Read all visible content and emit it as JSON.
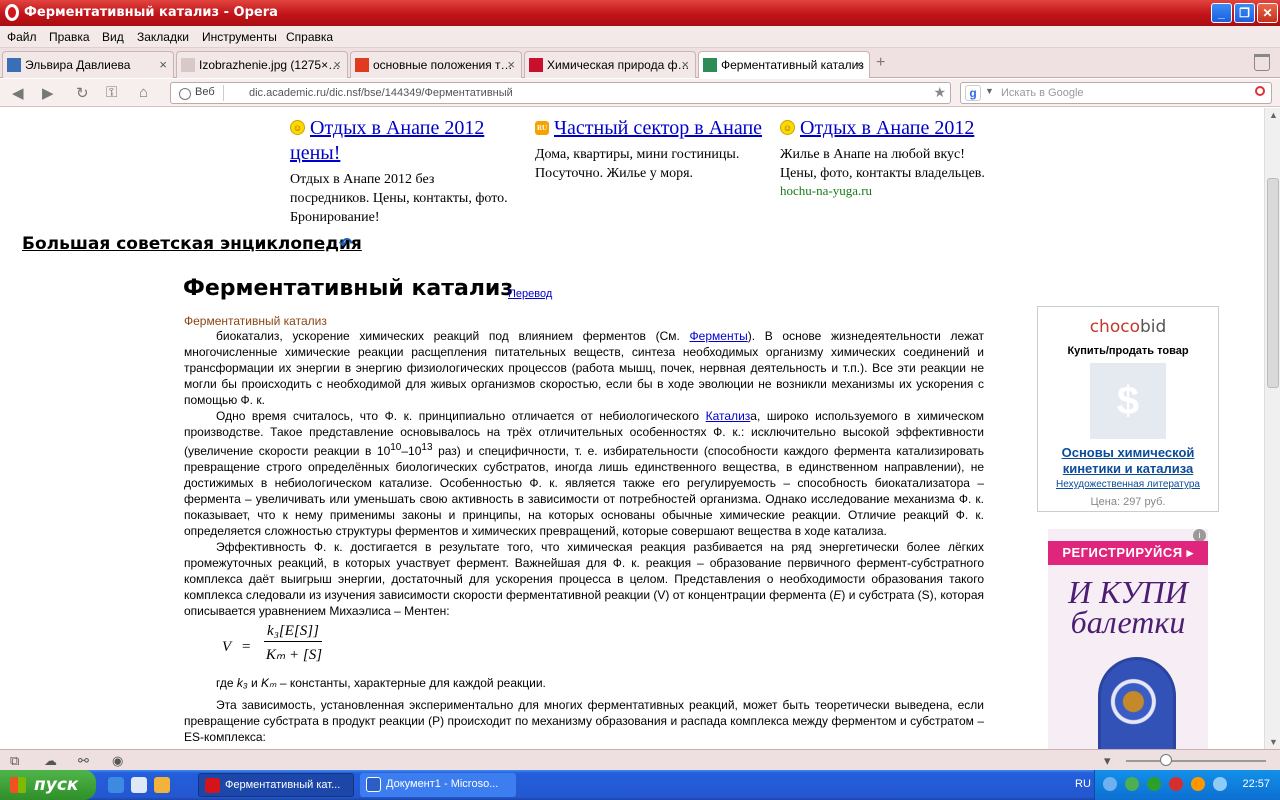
{
  "window": {
    "title": "Ферментативный катализ - Opera",
    "buttons": [
      "_",
      "❐",
      "✕"
    ]
  },
  "menu": [
    "Файл",
    "Правка",
    "Вид",
    "Закладки",
    "Инструменты",
    "Справка"
  ],
  "tabs": [
    {
      "label": "Эльвира Давлиева",
      "icon_color": "#3a6fb8"
    },
    {
      "label": "Izobrazhenie.jpg (1275×…",
      "icon_color": "#d9c8c8"
    },
    {
      "label": "основные положения т…",
      "icon_color": "#e03b1f"
    },
    {
      "label": "Химическая природа ф…",
      "icon_color": "#c8102e"
    },
    {
      "label": "Ферментативный катализ",
      "icon_color": "#2e8b57"
    }
  ],
  "address": {
    "web_label": "Веб",
    "url": "dic.academic.ru/dic.nsf/bse/144349/Ферментативный",
    "search_placeholder": "Искать в Google"
  },
  "ads": [
    {
      "headline": "Отдых в Анапе 2012 цены!",
      "body": "Отдых в Анапе 2012 без посредников. Цены, контакты, фото. Бронирование!",
      "icon": "smiley-icon"
    },
    {
      "headline": "Частный сектор в Анапе",
      "body": "Дома, квартиры, мини гостиницы. Посуточно. Жилье у моря.",
      "icon": "rss-icon"
    },
    {
      "headline": "Отдых в Анапе 2012",
      "body": "Жилье в Анапе на любой вкус! Цены, фото, контакты владельцев.",
      "source": "hochu-na-yuga.ru",
      "icon": "smiley-icon"
    }
  ],
  "encyclopedia": "Большая советская энциклопедия",
  "article": {
    "title": "Ферментативный катализ",
    "translate_link": "Перевод",
    "subtitle": "Ферментативный катализ",
    "p1_a": "биокатализ, ускорение химических реакций под влиянием ферментов (См. ",
    "p1_link": "Ферменты",
    "p1_b": "). В основе жизнедеятельности лежат многочисленные химические реакции расщепления питательных веществ, синтеза необходимых организму химических соединений и трансформации их энергии в энергию физиологических процессов (работа мышц, почек, нервная деятельность и т.п.). Все эти реакции не могли бы происходить с необходимой для живых организмов скоростью, если бы в ходе эволюции не возникли механизмы их ускорения с помощью Ф. к.",
    "p2_a": "Одно время считалось, что Ф. к. принципиально отличается от небиологического ",
    "p2_link": "Катализ",
    "p2_b": "а, широко используемого в химическом производстве. Такое представление основывалось на трёх отличительных особенностях Ф. к.: исключительно высокой эффективности (увеличение скорости реакции в 10",
    "p2_sup1": "10",
    "p2_c": "–10",
    "p2_sup2": "13",
    "p2_d": " раз) и специфичности, т. е. избирательности (способности каждого фермента катализировать превращение строго определённых биологических субстратов, иногда лишь единственного вещества, в единственном направлении), не достижимых в небиологическом катализе. Особенностью Ф. к. является также его регулируемость – способность биокатализатора – фермента – увеличивать или уменьшать свою активность в зависимости от потребностей организма. Однако исследование механизма Ф. к. показывает, что к нему применимы законы и принципы, на которых основаны обычные химические реакции. Отличие реакций Ф. к. определяется сложностью структуры ферментов и химических превращений, которые совершают вещества в ходе катализа.",
    "p3": "Эффективность Ф. к. достигается в результате того, что химическая реакция разбивается на ряд энергетически более лёгких промежуточных реакций, в которых участвует фермент. Важнейшая для Ф. к. реакция – образование первичного фермент-субстратного комплекса даёт выигрыш энергии, достаточный для ускорения процесса в целом. Представления о необходимости образования такого комплекса следовали из изучения зависимости скорости ферментативной реакции (V) от концентрации фермента (",
    "p3_e": "E",
    "p3_b": ") и субстрата (S), которая описывается уравнением Михаэлиса – Ментен:",
    "formula": {
      "lhs": "V",
      "eq": "=",
      "numerator": "k₃[E[S]]",
      "denominator": "Kₘ + [S]"
    },
    "p4_a": "где ",
    "p4_k3": "k₃",
    "p4_and": " и ",
    "p4_km": "Kₘ",
    "p4_b": " – константы, характерные для каждой реакции.",
    "p5": "Эта зависимость, установленная экспериментально для многих ферментативных реакций, может быть теоретически выведена, если превращение субстрата в продукт реакции (P) происходит по механизму образования и распада комплекса между ферментом и субстратом – ES-комплекса:"
  },
  "sidebar_ad": {
    "logo_choco": "choco",
    "logo_bid": "bid",
    "caption": "Купить/продать товар",
    "image_glyph": "$",
    "book": "Основы химической кинетики и катализа",
    "category": "Нехудожественная литература",
    "price": "Цена: 297 руб."
  },
  "banner": {
    "register": "РЕГИСТРИРУЙСЯ ▸",
    "line1": "И КУПИ",
    "line2": "балетки",
    "info": "i"
  },
  "taskbar": {
    "start": "пуск",
    "tasks": [
      "Ферментативный кат...",
      "Документ1 - Microso..."
    ],
    "lang": "RU",
    "clock": "22:57"
  }
}
